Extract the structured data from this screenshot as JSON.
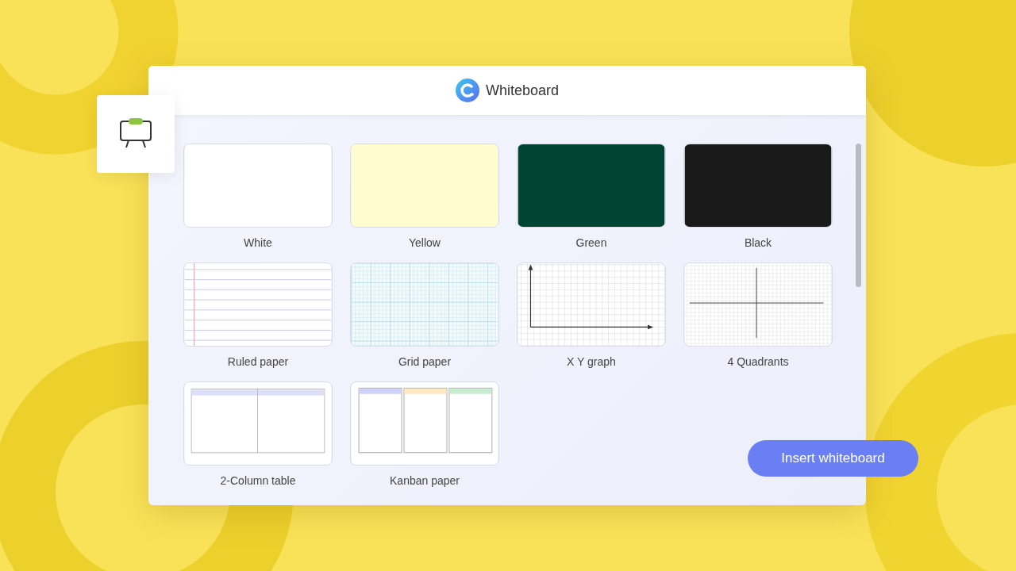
{
  "window": {
    "title": "Whiteboard"
  },
  "templates": [
    {
      "label": "White",
      "kind": "solid",
      "color": "#ffffff"
    },
    {
      "label": "Yellow",
      "kind": "solid",
      "color": "#fffcd0"
    },
    {
      "label": "Green",
      "kind": "solid",
      "color": "#004433"
    },
    {
      "label": "Black",
      "kind": "solid",
      "color": "#1a1a1a"
    },
    {
      "label": "Ruled paper",
      "kind": "ruled"
    },
    {
      "label": "Grid paper",
      "kind": "grid"
    },
    {
      "label": "X Y graph",
      "kind": "xy"
    },
    {
      "label": "4 Quadrants",
      "kind": "quadrants"
    },
    {
      "label": "2-Column table",
      "kind": "columns"
    },
    {
      "label": "Kanban paper",
      "kind": "kanban"
    }
  ],
  "insert_button": {
    "label": "Insert whiteboard"
  }
}
